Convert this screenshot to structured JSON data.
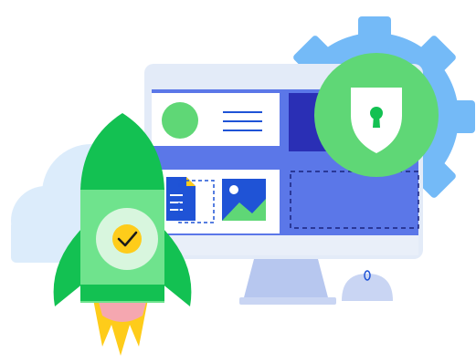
{
  "palette": {
    "gear": "#74baf7",
    "cloud": "#dcecfb",
    "monitor_frame": "#e3ebf8",
    "screen": "#5b77e8",
    "card": "#ffffff",
    "dark_blue": "#2a2fb5",
    "doc_blue": "#1f53d6",
    "shield_green": "#5fd776",
    "rocket_green": "#13c152",
    "rocket_light": "#6fe38d",
    "flame_yellow": "#fecc1a",
    "flame_pink": "#f5a7b0"
  },
  "icons": [
    "gear-icon",
    "cloud-icon",
    "monitor-icon",
    "avatar-circle-icon",
    "document-icon",
    "image-icon",
    "shield-lock-icon",
    "rocket-icon",
    "checkmark-icon",
    "mouse-icon"
  ]
}
